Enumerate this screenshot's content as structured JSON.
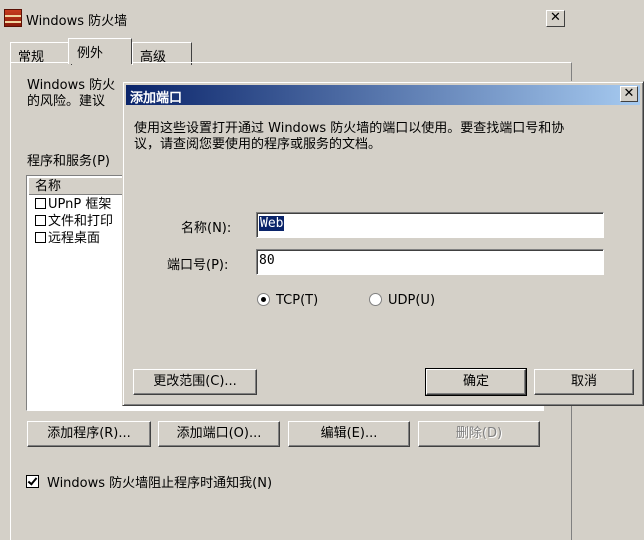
{
  "window": {
    "title": "Windows 防火墙",
    "close_label": "✕",
    "tabs": [
      {
        "label": "常规"
      },
      {
        "label": "例外"
      },
      {
        "label": "高级"
      }
    ]
  },
  "exceptions": {
    "description_line1": "Windows 防火",
    "description_line2": "的风险。建议",
    "list_label": "程序和服务(P)",
    "list_header": "名称",
    "items": [
      {
        "label": "UPnP 框架",
        "checked": false
      },
      {
        "label": "文件和打印",
        "checked": false
      },
      {
        "label": "远程桌面",
        "checked": false
      }
    ],
    "buttons": {
      "add_program": "添加程序(R)...",
      "add_port": "添加端口(O)...",
      "edit": "编辑(E)...",
      "delete": "删除(D)"
    },
    "notify_label": "Windows 防火墙阻止程序时通知我(N)",
    "notify_checked": true
  },
  "dialog": {
    "title": "添加端口",
    "close_label": "✕",
    "description_line1": "使用这些设置打开通过 Windows 防火墙的端口以使用。要查找端口号和协",
    "description_line2": "议，请查阅您要使用的程序或服务的文档。",
    "name_label": "名称(N):",
    "name_value": "Web",
    "port_label": "端口号(P):",
    "port_value": "80",
    "protocol": {
      "tcp_label": "TCP(T)",
      "udp_label": "UDP(U)",
      "selected": "TCP"
    },
    "change_scope": "更改范围(C)...",
    "ok": "确定",
    "cancel": "取消"
  },
  "colors": {
    "title_active_start": "#0a246a",
    "title_active_end": "#a6caf0",
    "face": "#d4d0c8"
  }
}
